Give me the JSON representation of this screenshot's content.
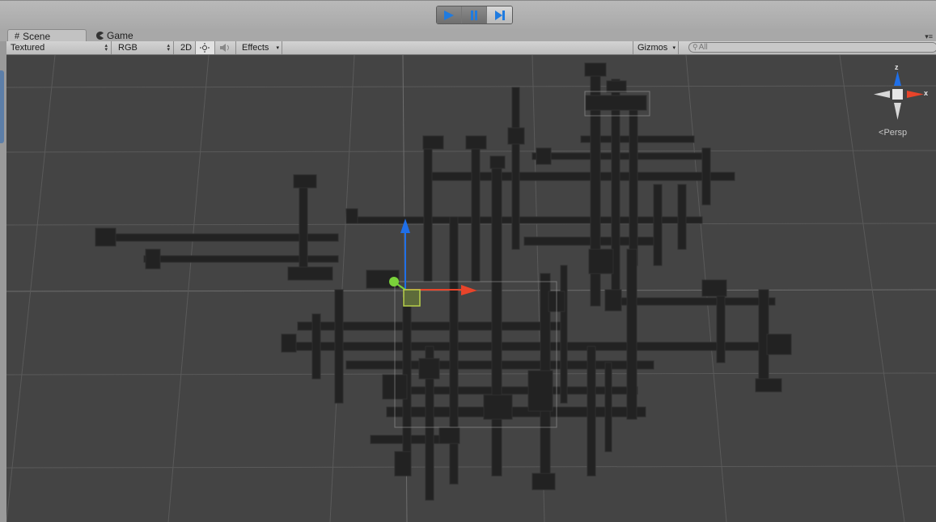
{
  "playbar": {
    "play_icon": "play-icon",
    "pause_icon": "pause-icon",
    "step_icon": "step-icon",
    "accent": "#1f7be0"
  },
  "tabs": [
    {
      "label": "Scene",
      "icon": "scene-hash-icon",
      "active": true
    },
    {
      "label": "Game",
      "icon": "game-pacman-icon",
      "active": false
    }
  ],
  "toolbar": {
    "draw_mode": "Textured",
    "render_mode": "RGB",
    "mode_2d": "2D",
    "lighting_icon": "sun-icon",
    "audio_icon": "speaker-icon",
    "effects": "Effects",
    "gizmos": "Gizmos",
    "search_placeholder": "All",
    "search_icon": "search-icon"
  },
  "scene_gizmo": {
    "z": "z",
    "x": "x",
    "projection": "Persp"
  },
  "colors": {
    "grid_bg": "#444444",
    "geometry": "#222222",
    "axis_x": "#e8442a",
    "axis_y": "#1f6fe8",
    "axis_z": "#7ad23a"
  }
}
